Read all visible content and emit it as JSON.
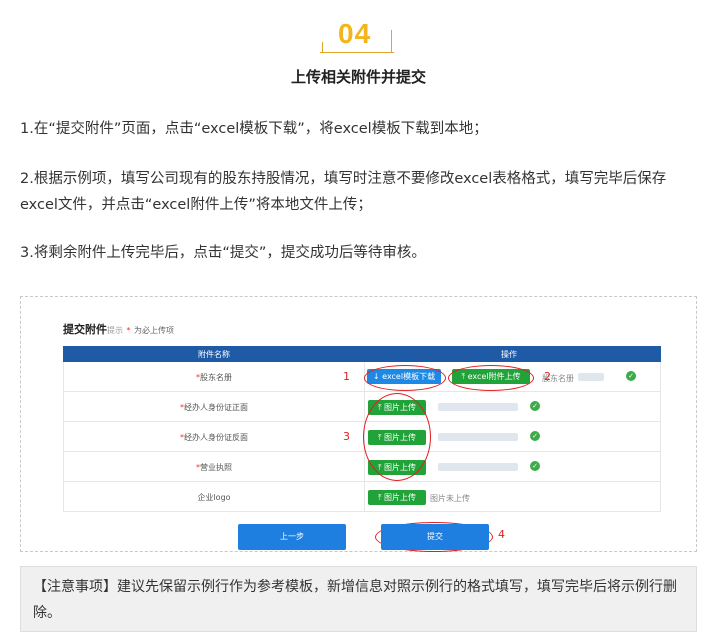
{
  "badge": {
    "number": "04"
  },
  "title": "上传相关附件并提交",
  "steps": [
    "1.在“提交附件”页面，点击“excel模板下载”，将excel模板下载到本地；",
    "2.根据示例项，填写公司现有的股东持股情况，填写时注意不要修改excel表格格式，填写完毕后保存excel文件，并点击“excel附件上传”将本地文件上传；",
    "3.将剩余附件上传完毕后，点击“提交”，提交成功后等待审核。"
  ],
  "screenshot": {
    "heading": "提交附件",
    "heading_hint": "提示",
    "required_star": "*",
    "required_note": "为必上传项",
    "columns": [
      "附件名称",
      "操作"
    ],
    "rows": [
      {
        "star": "*",
        "name": "股东名册",
        "buttons": [
          "excel模板下载",
          "excel附件上传"
        ],
        "file": "股东名册"
      },
      {
        "star": "*",
        "name": "经办人身份证正面",
        "button": "图片上传"
      },
      {
        "star": "*",
        "name": "经办人身份证反面",
        "button": "图片上传"
      },
      {
        "star": "*",
        "name": "营业执照",
        "button": "图片上传"
      },
      {
        "star": "",
        "name": "企业logo",
        "button": "图片上传",
        "status": "图片未上传"
      }
    ],
    "prev_label": "上一步",
    "submit_label": "提交",
    "markers": [
      "1",
      "2",
      "3",
      "4"
    ],
    "colors": {
      "header": "#1f5aa6",
      "blue_button": "#1e88e5",
      "green_button": "#21a33a",
      "marker": "#e02020"
    }
  },
  "note": "【注意事项】建议先保留示例行作为参考模板，新增信息对照示例行的格式填写，填写完毕后将示例行删除。"
}
